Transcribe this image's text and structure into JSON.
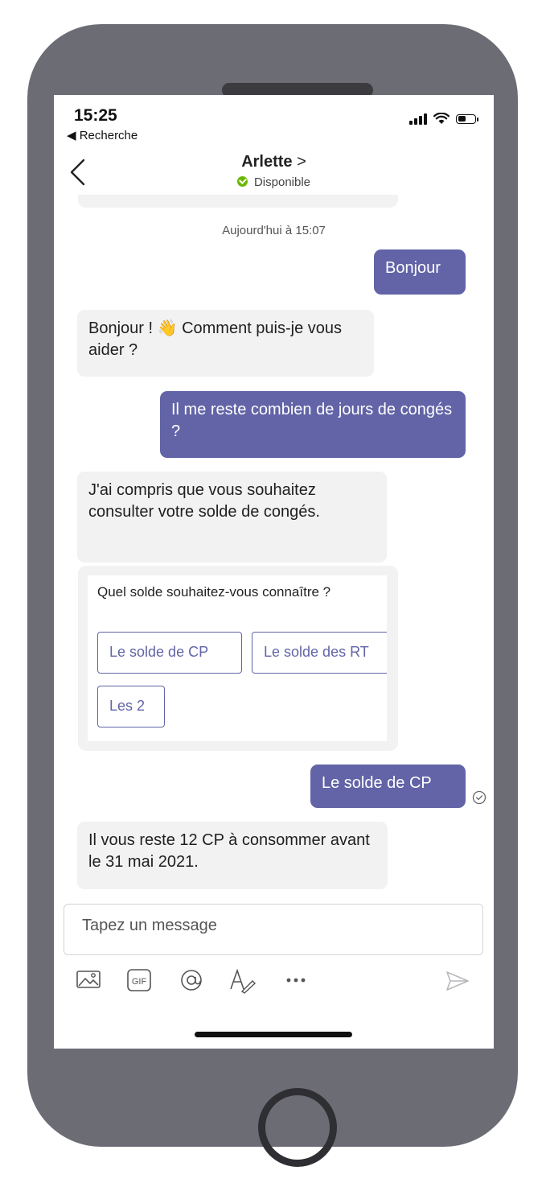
{
  "status_bar": {
    "time": "15:25",
    "back_app": "◀ Recherche"
  },
  "header": {
    "contact_name": "Arlette",
    "name_chevron": ">",
    "presence": "Disponible",
    "presence_color": "#6bb700"
  },
  "conversation": {
    "timestamp": "Aujourd'hui à 15:07",
    "messages": [
      {
        "sender": "me",
        "text": "Bonjour"
      },
      {
        "sender": "bot",
        "text": "Bonjour ! 👋 Comment puis-je vous aider ?"
      },
      {
        "sender": "me",
        "text": "Il me reste combien de jours de congés ?"
      },
      {
        "sender": "bot",
        "text": "J'ai compris que vous souhaitez consulter votre solde de congés."
      },
      {
        "sender": "me",
        "text": "Le solde de CP"
      },
      {
        "sender": "bot",
        "text": "Il vous reste 12 CP à consommer avant le 31 mai 2021."
      }
    ],
    "card": {
      "question": "Quel solde souhaitez-vous connaître ?",
      "options": [
        "Le solde de CP",
        "Le solde des RT",
        "Les 2"
      ]
    }
  },
  "compose": {
    "placeholder": "Tapez un message",
    "tools": [
      "image-icon",
      "gif-icon",
      "mention-icon",
      "format-icon",
      "more-icon",
      "send-icon"
    ]
  },
  "colors": {
    "accent": "#6264a7",
    "incoming_bubble": "#f2f2f3",
    "phone_body": "#6c6c75"
  }
}
